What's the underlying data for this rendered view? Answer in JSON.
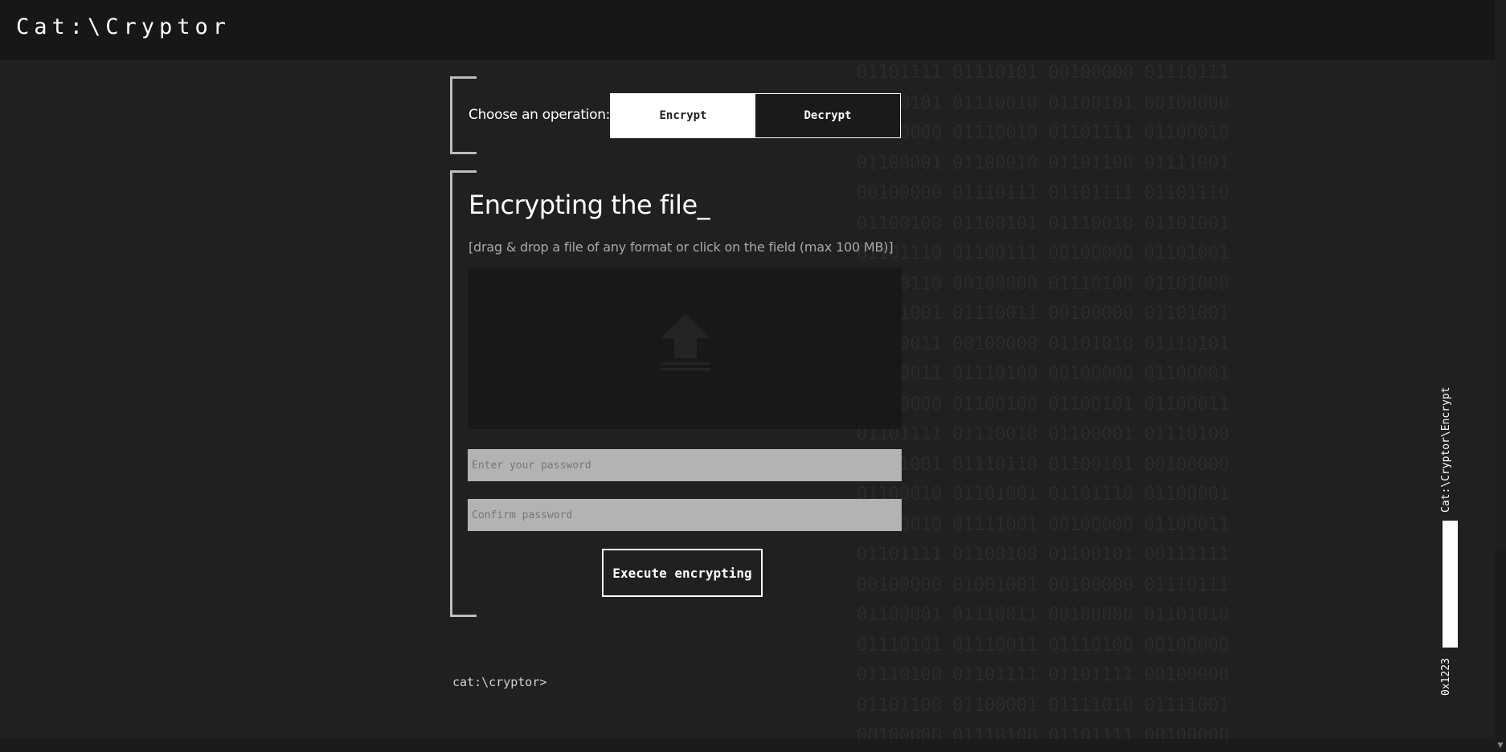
{
  "app": {
    "logo": "Cat:\\Cryptor"
  },
  "operation": {
    "label": "Choose an operation:",
    "options": [
      "Encrypt",
      "Decrypt"
    ],
    "selected": "Encrypt"
  },
  "main": {
    "title": "Encrypting the file_",
    "hint": "[drag & drop a file of any format or click on the field (max 100 MB)]",
    "password_placeholder": "Enter your password",
    "confirm_placeholder": "Confirm password",
    "execute_label": "Execute encrypting"
  },
  "prompt": "cat:\\cryptor>",
  "side": {
    "path": "Cat:\\Cryptor\\Encrypt",
    "code": "0x1223"
  },
  "binary_lines": [
    "01101111 01110101 00100000 01110111",
    "01100101 01110010 01100101 00100000",
    "00100000 01110010 01101111 01100010",
    "01100001 01100010 01101100 01111001",
    "00100000 01110111 01101111 01101110",
    "01100100 01100101 01110010 01101001",
    "01101110 01100111 00100000 01101001",
    "01100110 00100000 01110100 01101000",
    "01101001 01110011 00100000 01101001",
    "01110011 00100000 01101010 01110101",
    "01110011 01110100 00100000 01100001",
    "00100000 01100100 01100101 01100011",
    "01101111 01110010 01100001 01110100",
    "01101001 01110110 01100101 00100000",
    "01100010 01101001 01101110 01100001",
    "01110010 01111001 00100000 01100011",
    "01101111 01100100 01100101 00111111",
    "00100000 01001001 00100000 01110111",
    "01100001 01110011 00100000 01101010",
    "01110101 01110011 01110100 00100000",
    "01110100 01101111 01101111 00100000",
    "01101100 01100001 01111010 01111001",
    "00100000 01110100 01101111 00100000"
  ],
  "colors": {
    "background": "#202020",
    "topbar": "#171717",
    "accent": "#ffffff",
    "input_bg": "#b3b3b3"
  }
}
